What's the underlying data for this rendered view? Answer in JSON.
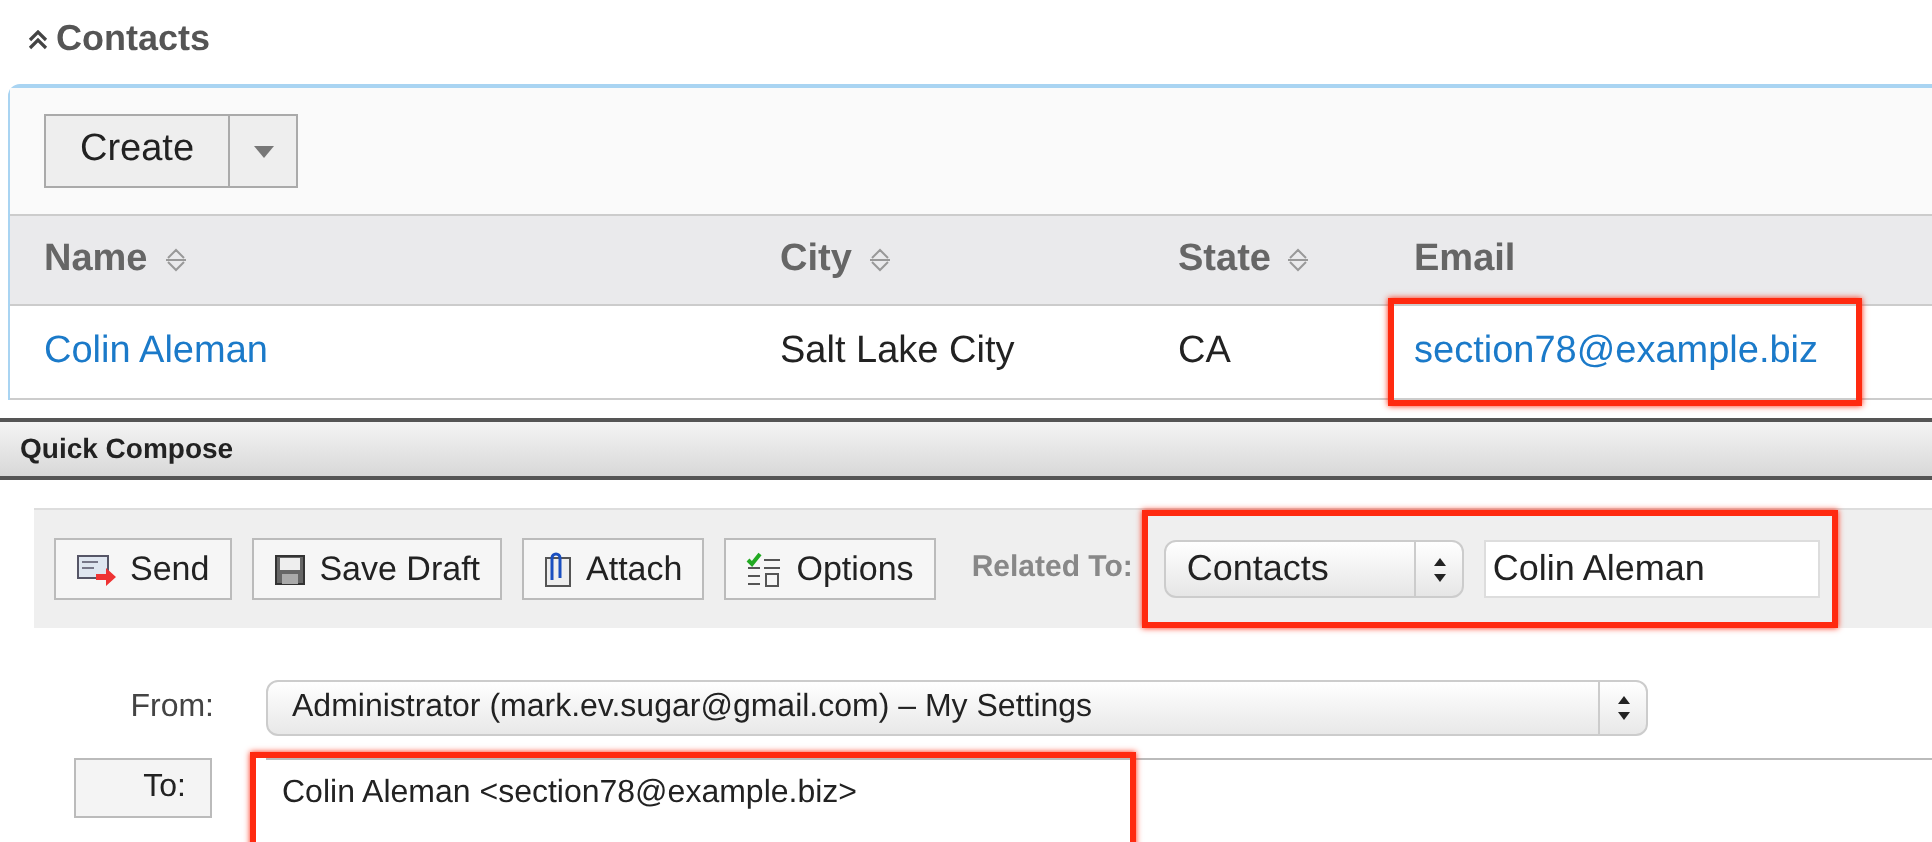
{
  "contacts": {
    "title": "Contacts",
    "create_button": "Create",
    "columns": [
      {
        "label": "Name",
        "sortable": true
      },
      {
        "label": "City",
        "sortable": true
      },
      {
        "label": "State",
        "sortable": true
      },
      {
        "label": "Email",
        "sortable": false
      }
    ],
    "rows": [
      {
        "name": "Colin Aleman",
        "city": "Salt Lake City",
        "state": "CA",
        "email": "section78@example.biz",
        "email_highlighted": true
      }
    ]
  },
  "quick_compose": {
    "title": "Quick Compose",
    "toolbar": [
      {
        "kind": "send",
        "label": "Send"
      },
      {
        "kind": "save",
        "label": "Save Draft"
      },
      {
        "kind": "attach",
        "label": "Attach"
      },
      {
        "kind": "options",
        "label": "Options"
      }
    ],
    "related_to": {
      "label": "Related To:",
      "module": "Contacts",
      "record": "Colin Aleman",
      "highlighted": true
    },
    "from": {
      "label": "From:",
      "value": "Administrator (mark.ev.sugar@gmail.com) – My Settings"
    },
    "to": {
      "button": "To:",
      "value": "Colin Aleman <section78@example.biz>",
      "highlighted": true
    }
  }
}
